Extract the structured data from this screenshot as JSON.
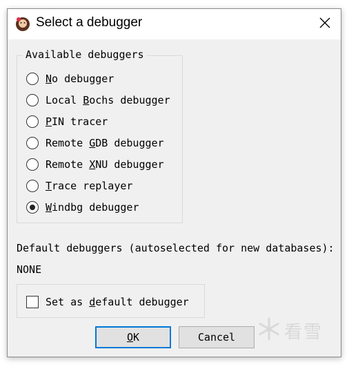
{
  "window": {
    "title": "Select a debugger",
    "icon": "ida-icon",
    "close_icon": "close-icon"
  },
  "available": {
    "legend": "Available debuggers",
    "options": [
      {
        "pre": "",
        "u": "N",
        "post": "o debugger",
        "checked": false
      },
      {
        "pre": "Local ",
        "u": "B",
        "post": "ochs debugger",
        "checked": false
      },
      {
        "pre": "",
        "u": "P",
        "post": "IN tracer",
        "checked": false
      },
      {
        "pre": "Remote ",
        "u": "G",
        "post": "DB debugger",
        "checked": false
      },
      {
        "pre": "Remote ",
        "u": "X",
        "post": "NU debugger",
        "checked": false
      },
      {
        "pre": "",
        "u": "T",
        "post": "race replayer",
        "checked": false
      },
      {
        "pre": "",
        "u": "W",
        "post": "indbg debugger",
        "checked": true
      }
    ]
  },
  "default_section": {
    "label": "Default debuggers (autoselected for new databases):",
    "value": "NONE"
  },
  "set_default": {
    "pre": "Set as ",
    "u": "d",
    "post": "efault debugger",
    "checked": false
  },
  "buttons": {
    "ok": {
      "pre": "",
      "u": "O",
      "post": "K"
    },
    "cancel": "Cancel"
  },
  "watermark": {
    "text": "看雪",
    "icon": "snowflake-icon"
  },
  "colors": {
    "dialog_bg": "#f0f0f0",
    "focus_border": "#0078d7"
  }
}
